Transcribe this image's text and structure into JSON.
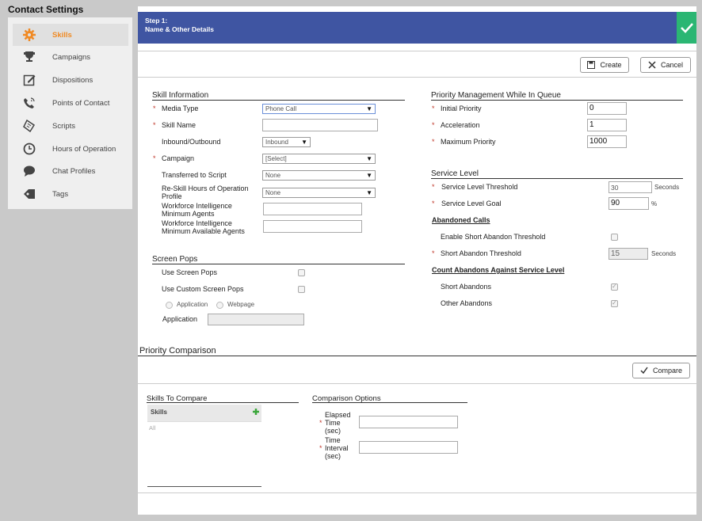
{
  "sidebar": {
    "title": "Contact Settings",
    "items": [
      {
        "label": "Skills",
        "icon": "gear-icon"
      },
      {
        "label": "Campaigns",
        "icon": "trophy-icon"
      },
      {
        "label": "Dispositions",
        "icon": "edit-icon"
      },
      {
        "label": "Points of Contact",
        "icon": "phone-icon"
      },
      {
        "label": "Scripts",
        "icon": "script-icon"
      },
      {
        "label": "Hours of Operation",
        "icon": "clock-icon"
      },
      {
        "label": "Chat Profiles",
        "icon": "chat-icon"
      },
      {
        "label": "Tags",
        "icon": "tag-icon"
      }
    ]
  },
  "step": {
    "title": "Step 1:",
    "subtitle": "Name & Other Details"
  },
  "toolbar": {
    "create_label": "Create",
    "cancel_label": "Cancel"
  },
  "skill_info": {
    "title": "Skill Information",
    "media_type_label": "Media Type",
    "media_type_value": "Phone Call",
    "skill_name_label": "Skill Name",
    "skill_name_value": "",
    "inbound_label": "Inbound/Outbound",
    "inbound_value": "Inbound",
    "campaign_label": "Campaign",
    "campaign_value": "[Select]",
    "transferred_label": "Transferred to Script",
    "transferred_value": "None",
    "reskill_label_1": "Re-Skill Hours of Operation",
    "reskill_label_2": "Profile",
    "reskill_value": "None",
    "wfi_min_label_1": "Workforce Intelligence",
    "wfi_min_label_2": "Minimum Agents",
    "wfi_avail_label_1": "Workforce Intelligence",
    "wfi_avail_label_2": "Minimum Available Agents"
  },
  "screen_pops": {
    "title": "Screen Pops",
    "use_label": "Use Screen Pops",
    "custom_label": "Use Custom Screen Pops",
    "radio_application": "Application",
    "radio_webpage": "Webpage",
    "application_label": "Application"
  },
  "priority": {
    "title": "Priority Management While In Queue",
    "initial_label": "Initial Priority",
    "initial_value": "0",
    "accel_label": "Acceleration",
    "accel_value": "1",
    "max_label": "Maximum Priority",
    "max_value": "1000"
  },
  "service_level": {
    "title": "Service Level",
    "threshold_label": "Service Level Threshold",
    "threshold_value": "30",
    "threshold_unit": "Seconds",
    "goal_label": "Service Level Goal",
    "goal_value": "90",
    "goal_unit": "%",
    "abandoned_title": "Abandoned Calls",
    "enable_short_label": "Enable Short Abandon Threshold",
    "short_threshold_label": "Short Abandon Threshold",
    "short_threshold_value": "15",
    "short_threshold_unit": "Seconds",
    "count_title": "Count Abandons Against Service Level",
    "short_abandons_label": "Short Abandons",
    "other_abandons_label": "Other Abandons"
  },
  "comparison": {
    "title": "Priority Comparison",
    "compare_label": "Compare",
    "skills_title": "Skills To Compare",
    "skills_header": "Skills",
    "skills_all": "All",
    "options_title": "Comparison Options",
    "elapsed_1": "Elapsed",
    "elapsed_2": "Time",
    "elapsed_3": "(sec)",
    "interval_1": "Time",
    "interval_2": "Interval",
    "interval_3": "(sec)"
  },
  "colors": {
    "accent": "#f08a24",
    "step_bar": "#3f55a2",
    "check": "#2bb673"
  }
}
